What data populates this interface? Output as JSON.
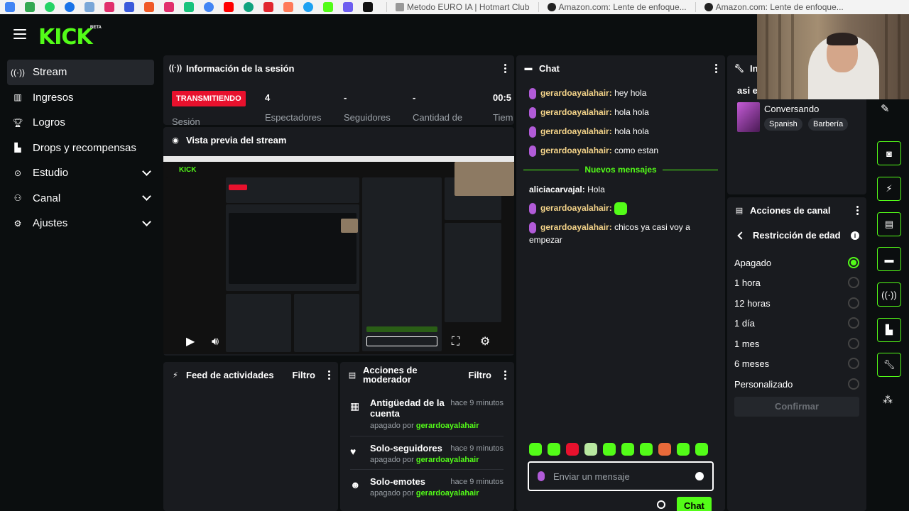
{
  "browser": {
    "tabs": [
      {
        "label": "Metodo EURO IA | Hotmart Club"
      },
      {
        "label": "Amazon.com: Lente de enfoque..."
      },
      {
        "label": "Amazon.com: Lente de enfoque..."
      }
    ]
  },
  "brand": {
    "logo": "KICK",
    "beta": "BETA",
    "accent": "#53fc18"
  },
  "sidebar": {
    "items": [
      {
        "label": "Stream",
        "icon": "broadcast-icon",
        "active": true
      },
      {
        "label": "Ingresos",
        "icon": "chart-icon"
      },
      {
        "label": "Logros",
        "icon": "trophy-icon"
      },
      {
        "label": "Drops y recompensas",
        "icon": "gift-icon"
      },
      {
        "label": "Estudio",
        "icon": "studio-icon",
        "expandable": true
      },
      {
        "label": "Canal",
        "icon": "users-icon",
        "expandable": true
      },
      {
        "label": "Ajustes",
        "icon": "gear-icon",
        "expandable": true
      }
    ]
  },
  "session": {
    "title": "Información de la sesión",
    "status": "TRANSMITIENDO",
    "status_label": "Sesión",
    "stats": [
      {
        "value": "4",
        "label": "Espectadores"
      },
      {
        "value": "-",
        "label": "Seguidores"
      },
      {
        "value": "-",
        "label": "Cantidad de"
      },
      {
        "value": "00:5",
        "label": "Tiem"
      }
    ]
  },
  "preview": {
    "title": "Vista previa del stream"
  },
  "chat": {
    "title": "Chat",
    "messages": [
      {
        "user": "gerardoayalahair:",
        "text": "hey hola"
      },
      {
        "user": "gerardoayalahair:",
        "text": "hola hola"
      },
      {
        "user": "gerardoayalahair:",
        "text": "hola hola"
      },
      {
        "user": "gerardoayalahair:",
        "text": "como estan"
      }
    ],
    "new_divider": "Nuevos mensajes",
    "new_messages": [
      {
        "user": "aliciacarvajal:",
        "text": "Hola"
      },
      {
        "user": "gerardoayalahair:",
        "text": ""
      },
      {
        "user": "gerardoayalahair:",
        "text": "chicos ya casi voy a empezar"
      }
    ],
    "placeholder": "Enviar un mensaje",
    "send_label": "Chat"
  },
  "stream_info": {
    "title": "Inf str",
    "stream_title": "asi edito mis videos",
    "category": "Conversando",
    "tags": [
      "Spanish",
      "Barbería"
    ]
  },
  "channel_actions": {
    "title": "Acciones de canal",
    "section": "Restricción de edad",
    "options": [
      {
        "label": "Apagado",
        "selected": true
      },
      {
        "label": "1 hora"
      },
      {
        "label": "12 horas"
      },
      {
        "label": "1 día"
      },
      {
        "label": "1 mes"
      },
      {
        "label": "6 meses"
      },
      {
        "label": "Personalizado"
      }
    ],
    "confirm": "Confirmar"
  },
  "activity_feed": {
    "title": "Feed de actividades",
    "filter": "Filtro"
  },
  "mod_actions": {
    "title": "Acciones de moderador",
    "filter": "Filtro",
    "items": [
      {
        "title": "Antigüedad de la cuenta",
        "time": "hace 9 minutos",
        "by_prefix": "apagado por",
        "by": "gerardoayalahair",
        "icon": "calendar-icon"
      },
      {
        "title": "Solo-seguidores",
        "time": "hace 9 minutos",
        "by_prefix": "apagado por",
        "by": "gerardoayalahair",
        "icon": "heart-icon"
      },
      {
        "title": "Solo-emotes",
        "time": "hace 9 minutos",
        "by_prefix": "apagado por",
        "by": "gerardoayalahair",
        "icon": "smile-icon"
      }
    ]
  }
}
